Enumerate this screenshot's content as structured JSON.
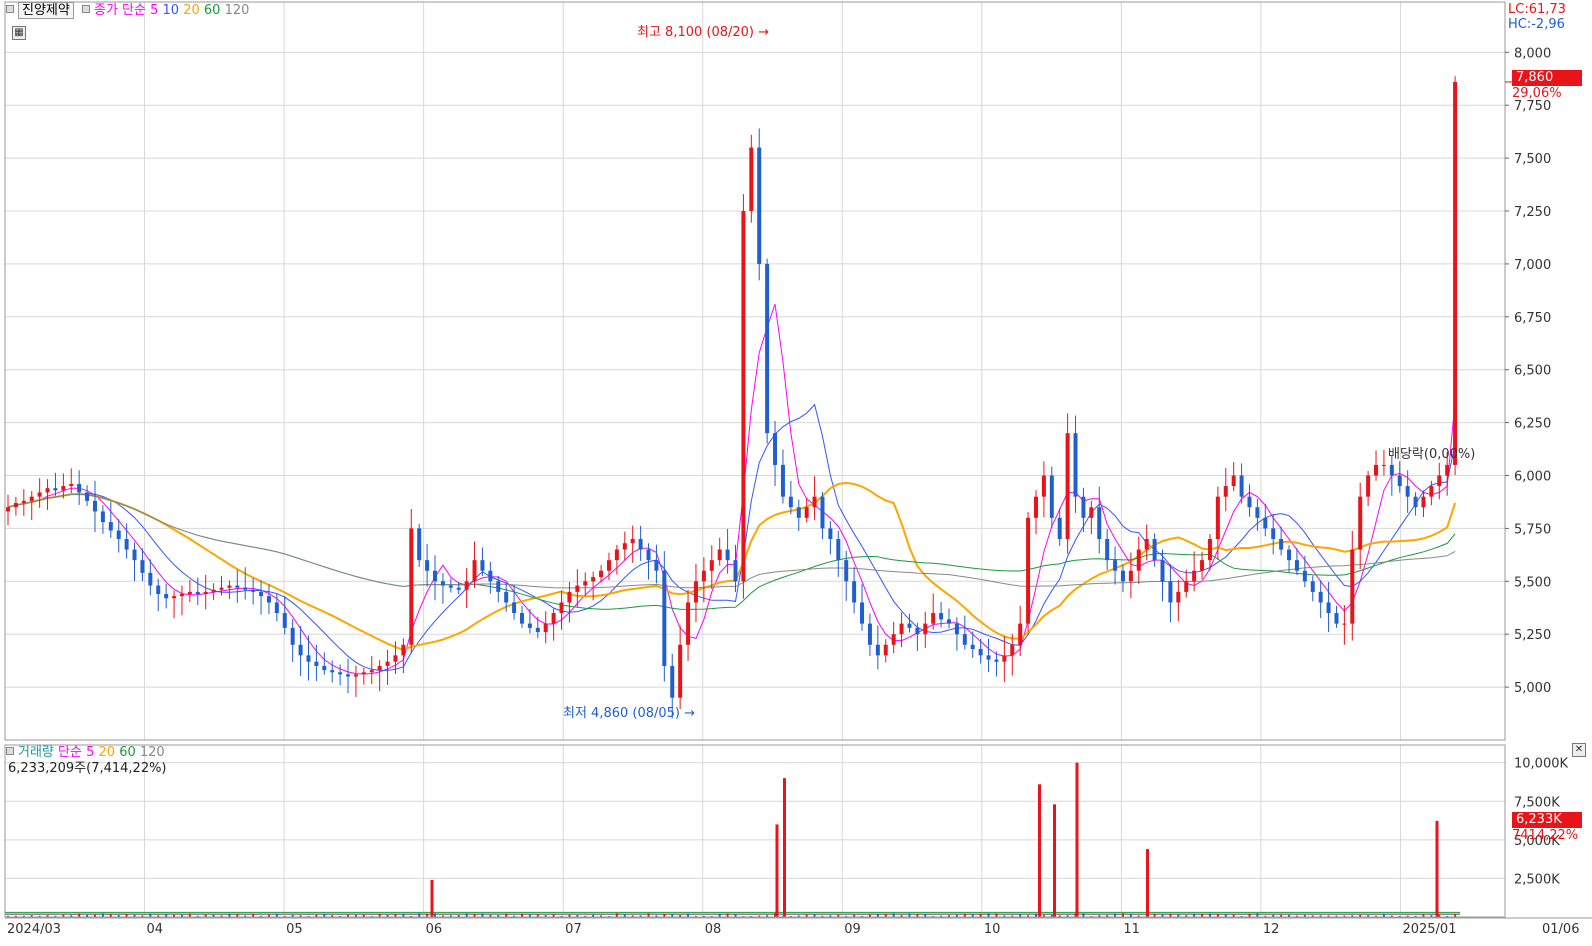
{
  "header": {
    "stock_name": "진양제약",
    "price_ma_label": "종가 단순",
    "price_ma_periods": [
      {
        "label": "5",
        "color": "#ff00ff"
      },
      {
        "label": "10",
        "color": "#3355ff"
      },
      {
        "label": "20",
        "color": "#ffa500"
      },
      {
        "label": "60",
        "color": "#1a9a3a"
      },
      {
        "label": "120",
        "color": "#888888"
      }
    ],
    "lc_label": "LC:61,73",
    "hc_label": "HC:-2,96",
    "volume_title": "거래량",
    "volume_ma_label": "단순",
    "volume_ma_periods": [
      {
        "label": "5",
        "color": "#ff00ff"
      },
      {
        "label": "20",
        "color": "#ffa500"
      },
      {
        "label": "60",
        "color": "#1a9a3a"
      },
      {
        "label": "120",
        "color": "#888888"
      }
    ],
    "volume_info": "6,233,209주(7,414,22%)"
  },
  "current_price": {
    "label": "7,860",
    "change": "29,06%"
  },
  "current_volume": {
    "label": "6,233K",
    "change": "7414,22%"
  },
  "annotations": {
    "high": "최고 8,100 (08/20)",
    "low": "최저 4,860 (08/05)",
    "dividend": "배당락(0,00%)"
  },
  "colors": {
    "up": "#e8141a",
    "down": "#1f5fd0",
    "grid": "#d8d8d8",
    "ma5": "#ff00ff",
    "ma10": "#3355ff",
    "ma20": "#ffa500",
    "ma60": "#1a9a3a",
    "ma120": "#888888"
  },
  "chart_data": [
    {
      "type": "candlestick",
      "title": "진양제약",
      "y_axis_ticks": [
        "5,000",
        "5,250",
        "5,500",
        "5,750",
        "6,000",
        "6,250",
        "6,500",
        "6,750",
        "7,000",
        "7,250",
        "7,500",
        "7,750",
        "8,000"
      ],
      "ylim": [
        4750,
        8200
      ],
      "x_axis_labels": [
        "2024/03",
        "04",
        "05",
        "06",
        "07",
        "08",
        "09",
        "10",
        "11",
        "12",
        "2025/01",
        "01/06"
      ],
      "approx_closes": [
        5850,
        5870,
        5880,
        5900,
        5920,
        5940,
        5930,
        5950,
        5960,
        5920,
        5880,
        5830,
        5780,
        5740,
        5700,
        5650,
        5600,
        5540,
        5480,
        5440,
        5420,
        5430,
        5440,
        5450,
        5440,
        5450,
        5460,
        5470,
        5480,
        5470,
        5460,
        5450,
        5430,
        5400,
        5350,
        5280,
        5200,
        5150,
        5120,
        5100,
        5080,
        5070,
        5060,
        5050,
        5060,
        5070,
        5080,
        5100,
        5120,
        5150,
        5200,
        5750,
        5600,
        5550,
        5500,
        5480,
        5470,
        5460,
        5500,
        5600,
        5550,
        5500,
        5450,
        5400,
        5350,
        5300,
        5280,
        5260,
        5300,
        5350,
        5400,
        5450,
        5480,
        5500,
        5520,
        5550,
        5600,
        5650,
        5680,
        5700,
        5650,
        5600,
        5550,
        5100,
        4950,
        5200,
        5400,
        5500,
        5550,
        5600,
        5650,
        5600,
        5500,
        7250,
        7550,
        7000,
        6200,
        6050,
        5900,
        5850,
        5800,
        5850,
        5900,
        5750,
        5700,
        5600,
        5500,
        5400,
        5300,
        5200,
        5150,
        5200,
        5250,
        5300,
        5280,
        5250,
        5300,
        5350,
        5320,
        5300,
        5250,
        5200,
        5180,
        5150,
        5130,
        5120,
        5150,
        5200,
        5300,
        5800,
        5900,
        6000,
        5800,
        5700,
        6200,
        5900,
        5800,
        5850,
        5700,
        5600,
        5550,
        5500,
        5550,
        5650,
        5700,
        5600,
        5500,
        5400,
        5450,
        5500,
        5550,
        5600,
        5700,
        5900,
        5950,
        6000,
        5900,
        5850,
        5800,
        5750,
        5700,
        5650,
        5600,
        5550,
        5500,
        5450,
        5400,
        5350,
        5300,
        5300,
        5650,
        5900,
        6000,
        6050,
        6050,
        6000,
        5950,
        5900,
        5850,
        5900,
        5950,
        6000,
        6050,
        7860
      ],
      "series": [
        {
          "name": "5",
          "color": "#ff00ff"
        },
        {
          "name": "10",
          "color": "#3355ff"
        },
        {
          "name": "20",
          "color": "#ffa500"
        },
        {
          "name": "60",
          "color": "#1a9a3a"
        },
        {
          "name": "120",
          "color": "#888888"
        }
      ]
    },
    {
      "type": "bar",
      "title": "거래량",
      "y_axis_ticks": [
        "2,500K",
        "5,000K",
        "7,500K",
        "10,000K"
      ],
      "ylim": [
        0,
        10500
      ],
      "notable_volumes_k": [
        {
          "x": "06",
          "value": 2400
        },
        {
          "x": "08/19",
          "value": 6000
        },
        {
          "x": "08/20",
          "value": 9000
        },
        {
          "x": "10",
          "value": 8600
        },
        {
          "x": "10",
          "value": 7300
        },
        {
          "x": "10",
          "value": 10000
        },
        {
          "x": "11",
          "value": 4400
        },
        {
          "x": "2025/01",
          "value": 6233
        }
      ]
    }
  ]
}
